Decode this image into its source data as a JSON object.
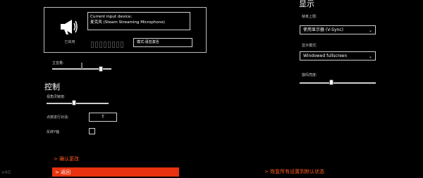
{
  "audio": {
    "device_title": "Current input device:",
    "device_name": "麦克风 (Steam Streaming Microphone)",
    "mic_status": "已启用",
    "mode": "模式:语音激活",
    "master_volume_label": "主音量:",
    "master_volume_value": 0.82,
    "mic_level_value": 0.0
  },
  "controls": {
    "title": "控制",
    "sensitivity_label": "视角灵敏度:",
    "sensitivity_value": 0.44,
    "push_to_talk_label": "点按进行对话:",
    "push_to_talk_key": "T",
    "invert_y_label": "反转Y轴",
    "invert_y_checked": false
  },
  "display": {
    "title": "显示",
    "framerate_label": "帧率上限:",
    "framerate_value": "使用显示器 (V-Sync)",
    "display_mode_label": "显示模式:",
    "display_mode_value": "Windowed fullscreen",
    "gamma_label": "伽玛亮度:",
    "gamma_value": 0.42
  },
  "actions": {
    "confirm": "> 确认更改",
    "back": "> 返回",
    "reset": "> 恢复所有设置到默认状态"
  },
  "version": "v40",
  "colors": {
    "accent": "#ff5a1f",
    "back_bar": "#e8320f",
    "background": "#000000"
  },
  "icons": {
    "mic": "megaphone-icon",
    "dropdown": "chevron-down-icon"
  }
}
